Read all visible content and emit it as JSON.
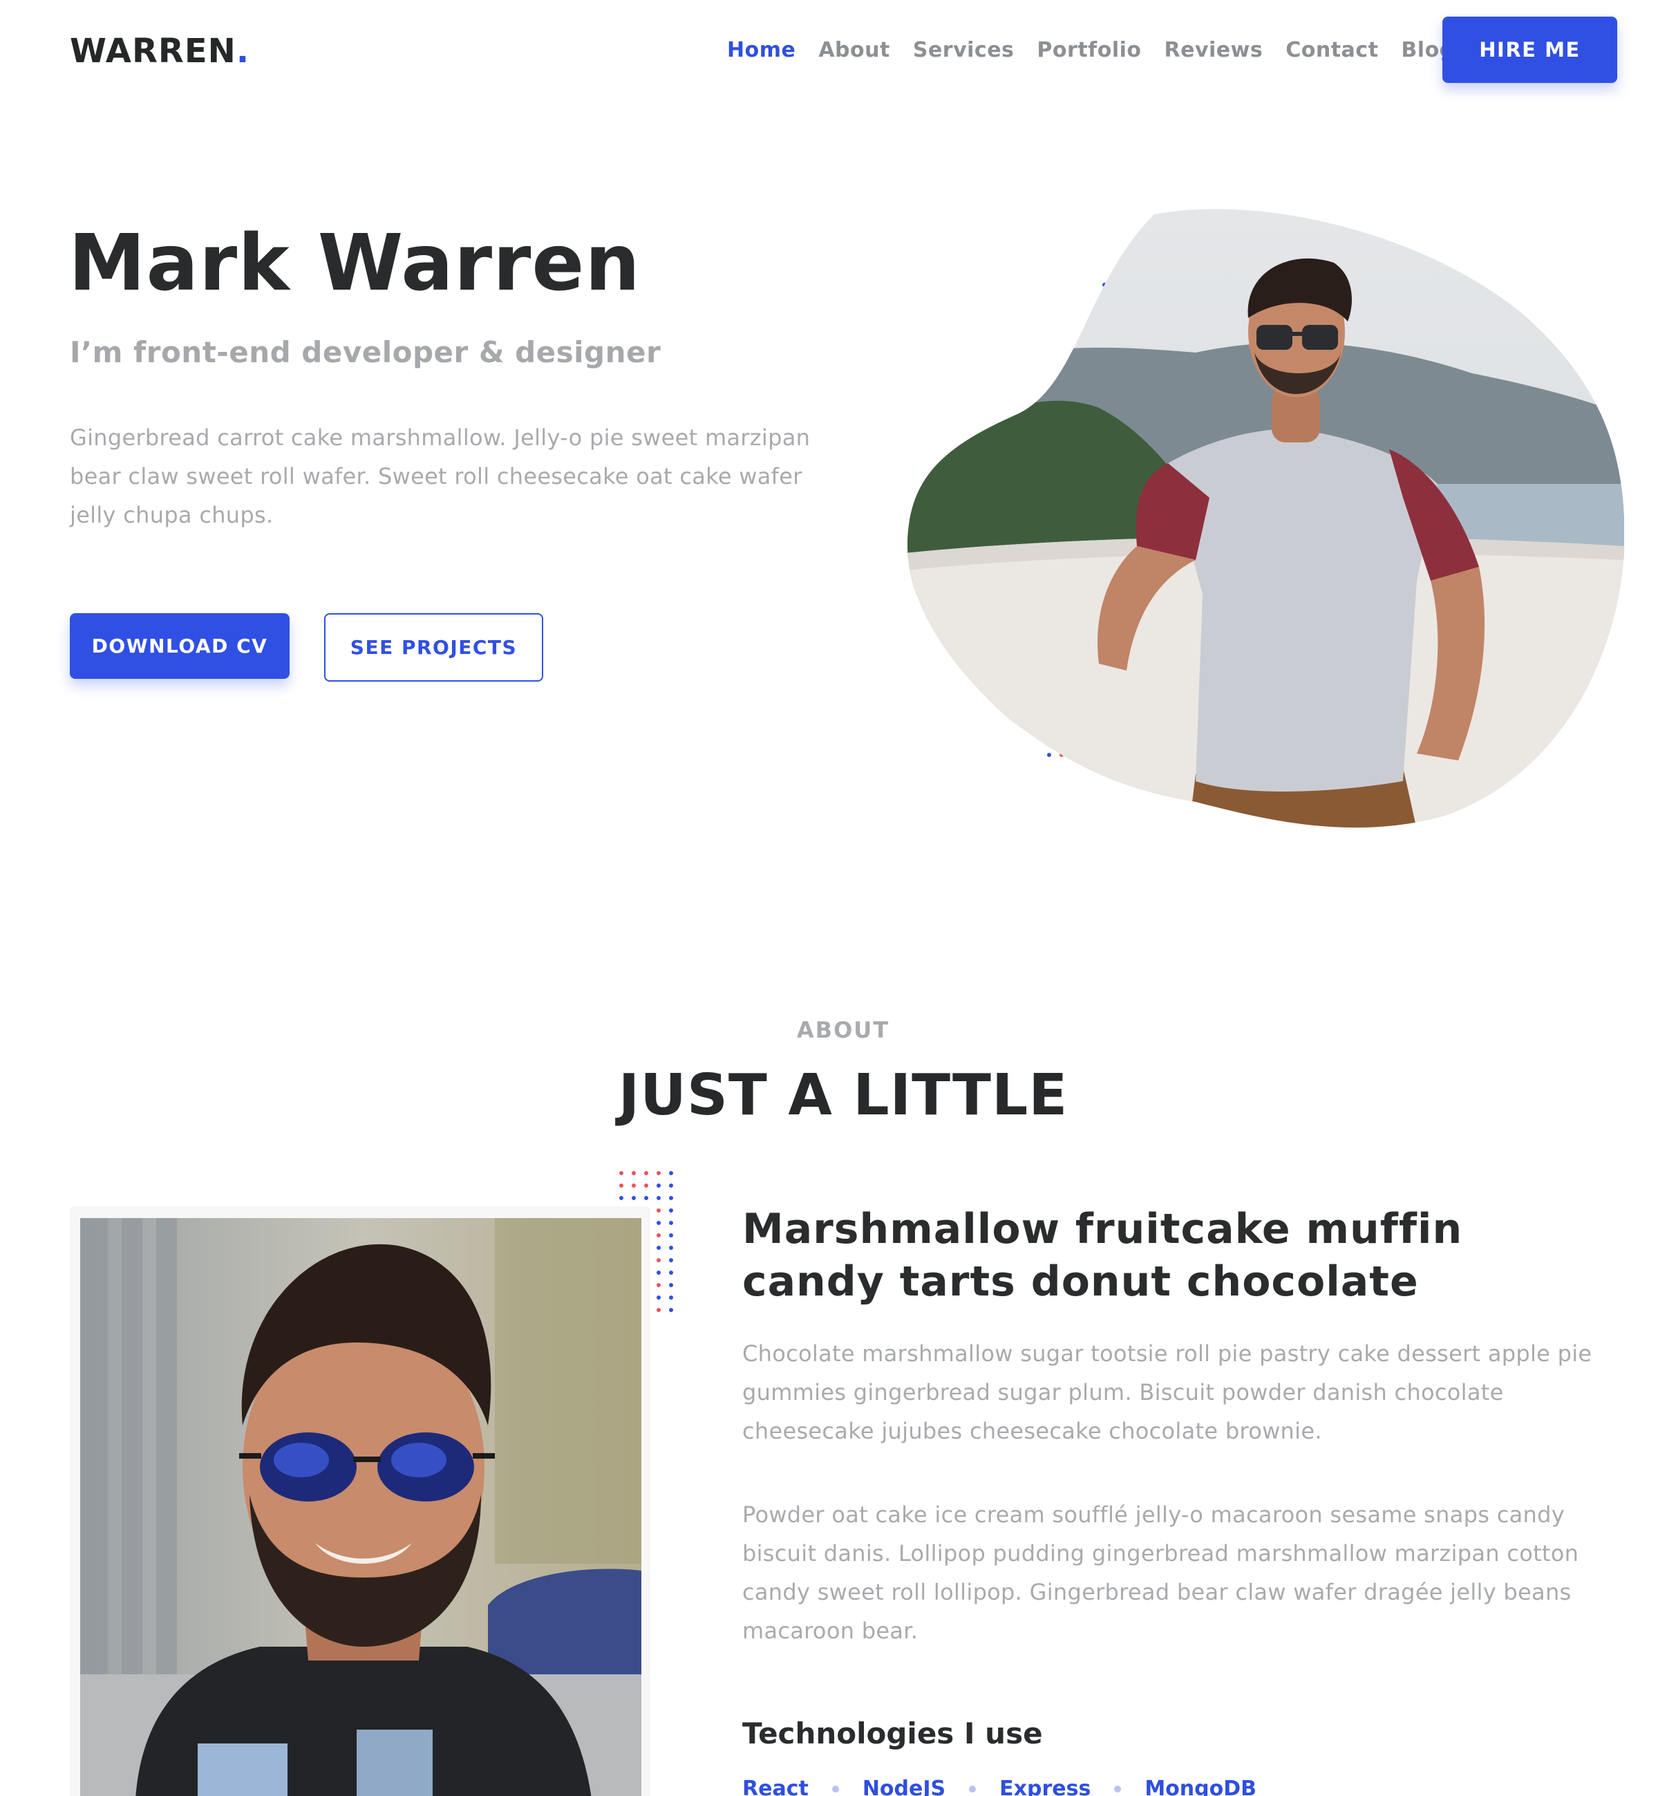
{
  "header": {
    "logo_text": "WARREN",
    "logo_dot": ".",
    "nav": [
      {
        "label": "Home",
        "active": true
      },
      {
        "label": "About"
      },
      {
        "label": "Services"
      },
      {
        "label": "Portfolio"
      },
      {
        "label": "Reviews"
      },
      {
        "label": "Contact"
      },
      {
        "label": "Blog"
      }
    ],
    "hire_label": "HIRE ME"
  },
  "hero": {
    "name": "Mark Warren",
    "subtitle": "I’m front-end developer & designer",
    "text": "Gingerbread carrot cake marshmallow. Jelly-o pie sweet marzipan bear claw sweet roll wafer. Sweet roll cheesecake oat cake wafer jelly chupa chups.",
    "download_label": "DOWNLOAD CV",
    "projects_label": "SEE PROJECTS"
  },
  "about": {
    "eyebrow": "ABOUT",
    "title": "JUST A LITTLE",
    "heading": "Marshmallow fruitcake muffin candy tarts donut chocolate",
    "p1": "Chocolate marshmallow sugar tootsie roll pie pastry cake dessert apple pie gummies gingerbread sugar plum. Biscuit powder danish chocolate cheesecake jujubes cheesecake chocolate brownie.",
    "p2": "Powder oat cake ice cream soufflé jelly-o macaroon sesame snaps candy biscuit danis. Lollipop pudding gingerbread marshmallow marzipan cotton candy sweet roll lollipop. Gingerbread bear claw wafer dragée jelly beans macaroon bear.",
    "tech_heading": "Technologies I use",
    "technologies": [
      "React",
      "NodeJS",
      "Express",
      "MongoDB"
    ]
  },
  "colors": {
    "accent": "#3050e3",
    "dot_red": "#e9545a",
    "dot_blue": "#3050e3",
    "text_dark": "#292b2d",
    "text_muted": "#a8aaad"
  }
}
